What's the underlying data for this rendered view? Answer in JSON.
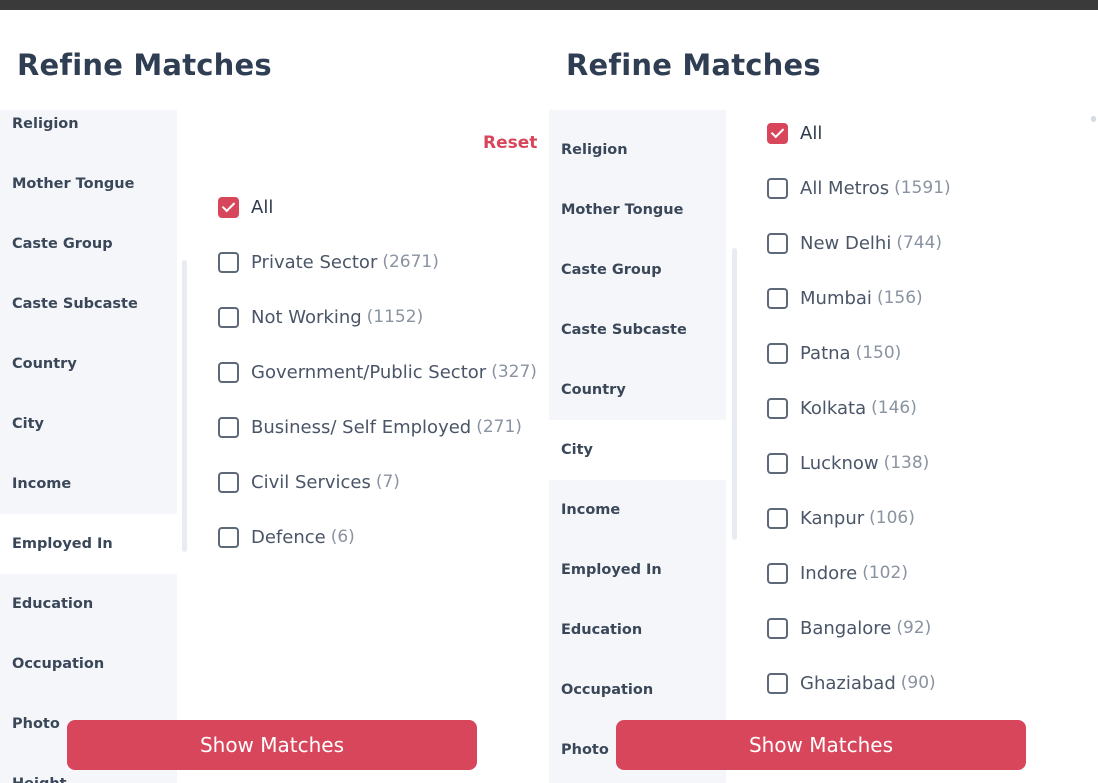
{
  "left_panel": {
    "title": "Refine Matches",
    "sidebar": [
      "Religion",
      "Mother Tongue",
      "Caste Group",
      "Caste Subcaste",
      "Country",
      "City",
      "Income",
      "Employed In",
      "Education",
      "Occupation",
      "Photo",
      "Height"
    ],
    "active_item": "Employed In",
    "reset_label": "Reset",
    "options": [
      {
        "label": "All",
        "count": "",
        "checked": true
      },
      {
        "label": "Private Sector",
        "count": "(2671)",
        "checked": false
      },
      {
        "label": "Not Working",
        "count": "(1152)",
        "checked": false
      },
      {
        "label": "Government/Public Sector",
        "count": "(327)",
        "checked": false
      },
      {
        "label": "Business/ Self Employed",
        "count": "(271)",
        "checked": false
      },
      {
        "label": "Civil Services",
        "count": "(7)",
        "checked": false
      },
      {
        "label": "Defence",
        "count": "(6)",
        "checked": false
      }
    ],
    "show_button": "Show Matches"
  },
  "right_panel": {
    "title": "Refine Matches",
    "sidebar": [
      "Religion",
      "Mother Tongue",
      "Caste Group",
      "Caste Subcaste",
      "Country",
      "City",
      "Income",
      "Employed In",
      "Education",
      "Occupation",
      "Photo"
    ],
    "active_item": "City",
    "options": [
      {
        "label": "All",
        "count": "",
        "checked": true
      },
      {
        "label": "All Metros",
        "count": "(1591)",
        "checked": false
      },
      {
        "label": "New Delhi",
        "count": "(744)",
        "checked": false
      },
      {
        "label": "Mumbai",
        "count": "(156)",
        "checked": false
      },
      {
        "label": "Patna",
        "count": "(150)",
        "checked": false
      },
      {
        "label": "Kolkata",
        "count": "(146)",
        "checked": false
      },
      {
        "label": "Lucknow",
        "count": "(138)",
        "checked": false
      },
      {
        "label": "Kanpur",
        "count": "(106)",
        "checked": false
      },
      {
        "label": "Indore",
        "count": "(102)",
        "checked": false
      },
      {
        "label": "Bangalore",
        "count": "(92)",
        "checked": false
      },
      {
        "label": "Ghaziabad",
        "count": "(90)",
        "checked": false
      }
    ],
    "show_button": "Show Matches"
  },
  "colors": {
    "accent": "#d8465c",
    "title": "#2f3e52",
    "sidebar_bg": "#f5f6f9"
  }
}
